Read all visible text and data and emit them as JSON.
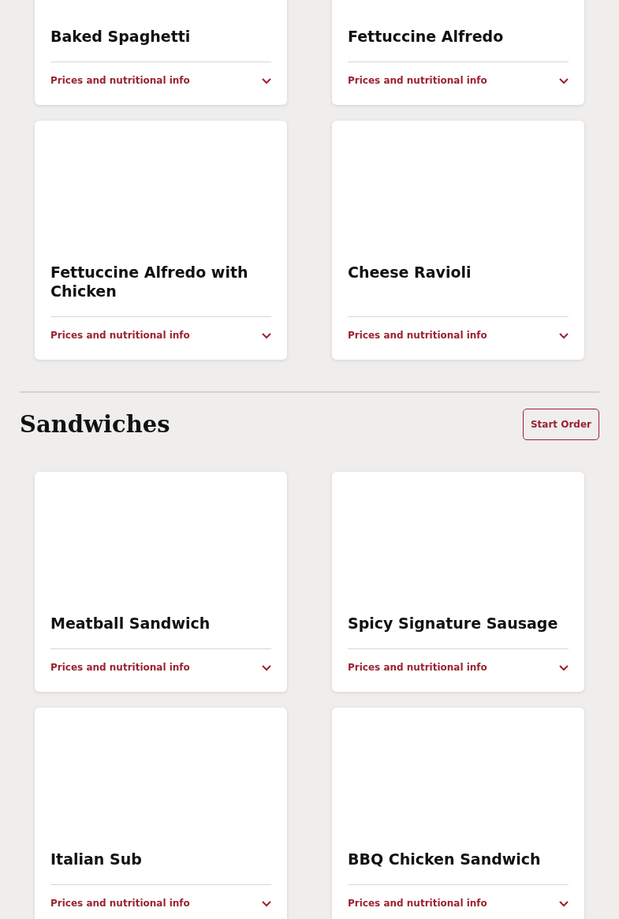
{
  "sections": [
    {
      "items": [
        {
          "name": "Baked Spaghetti",
          "toggle": {
            "label": "Prices and nutritional info",
            "expanded": false
          }
        },
        {
          "name": "Fettuccine Alfredo",
          "toggle": {
            "label": "Prices and nutritional info",
            "expanded": false
          }
        },
        {
          "name": "Fettuccine Alfredo with Chicken",
          "toggle": {
            "label": "Prices and nutritional info",
            "expanded": false
          }
        },
        {
          "name": "Cheese Ravioli",
          "toggle": {
            "label": "Prices and nutritional info",
            "expanded": false
          }
        }
      ]
    },
    {
      "heading": "Sandwiches",
      "button": "Start Order",
      "items": [
        {
          "name": "Meatball Sandwich",
          "toggle": {
            "label": "Prices and nutritional info",
            "expanded": false
          }
        },
        {
          "name": "Spicy Signature Sausage",
          "toggle": {
            "label": "Prices and nutritional info",
            "expanded": false
          }
        },
        {
          "name": "Italian Sub",
          "toggle": {
            "label": "Prices and nutritional info",
            "expanded": false
          }
        },
        {
          "name": "BBQ Chicken Sandwich",
          "toggle": {
            "label": "Prices and nutritional info",
            "expanded": false
          }
        }
      ]
    }
  ]
}
